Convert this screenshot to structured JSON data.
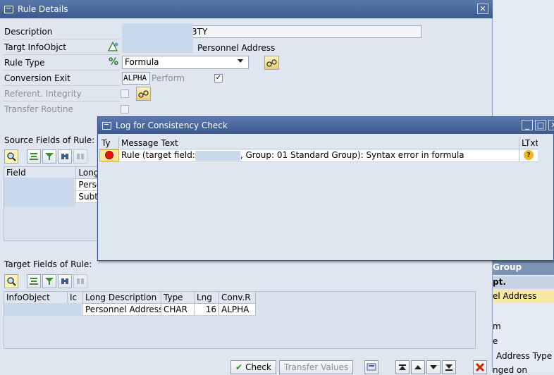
{
  "rule_dialog": {
    "title": "Rule Details",
    "fields": {
      "description": {
        "label": "Description",
        "value_suffix": "3TY"
      },
      "target_infoobject": {
        "label": "Targt InfoObjct",
        "desc": "Personnel Address"
      },
      "rule_type": {
        "label": "Rule Type",
        "value": "Formula"
      },
      "conversion_exit": {
        "label": "Conversion Exit",
        "value": "ALPHA",
        "perform_label": "Perform"
      },
      "referent_integrity": {
        "label": "Referent. Integrity"
      },
      "transfer_routine": {
        "label": "Transfer Routine"
      }
    },
    "source_fields": {
      "title": "Source Fields of Rule:",
      "columns": [
        "Field",
        "Long"
      ],
      "rows": [
        {
          "field": "",
          "long": "Perso"
        },
        {
          "field": "",
          "long": "Subt"
        }
      ]
    },
    "target_fields": {
      "title": "Target Fields of Rule:",
      "columns": [
        "InfoObject",
        "Ic",
        "Long Description",
        "Type",
        "Lng",
        "Conv.R"
      ],
      "rows": [
        {
          "infoobject": "",
          "ic": "",
          "long_description": "Personnel Address",
          "type": "CHAR",
          "lng": "16",
          "conv": "ALPHA"
        }
      ]
    },
    "buttons": {
      "check": "Check",
      "transfer_values": "Transfer Values"
    }
  },
  "log_dialog": {
    "title": "Log for Consistency Check",
    "columns": [
      "Ty",
      "Message Text",
      "LTxt"
    ],
    "rows": [
      {
        "message_prefix": "Rule (target field:",
        "message_suffix": ", Group: 01 Standard Group): Syntax error in formula"
      }
    ]
  },
  "background_panel": {
    "header": "Group",
    "items": [
      "pt.",
      "el Address",
      "m",
      "e",
      "Address Type",
      "nged on"
    ]
  },
  "colors": {
    "title_bar": "#3b5a8f",
    "error": "#e8150f",
    "highlight": "#f6e8a0"
  }
}
